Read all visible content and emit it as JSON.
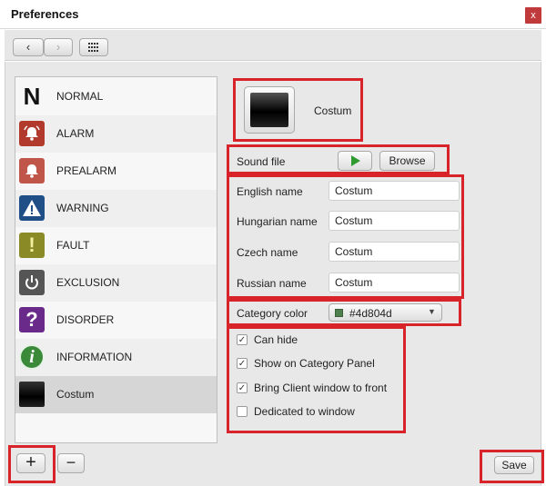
{
  "window": {
    "title": "Preferences",
    "close_glyph": "x"
  },
  "toolbar": {
    "back_glyph": "‹",
    "forward_glyph": "›"
  },
  "categories": [
    {
      "label": "NORMAL",
      "icon": "normal-icon"
    },
    {
      "label": "ALARM",
      "icon": "alarm-bell-icon"
    },
    {
      "label": "PREALARM",
      "icon": "prealarm-bell-icon"
    },
    {
      "label": "WARNING",
      "icon": "warning-triangle-icon"
    },
    {
      "label": "FAULT",
      "icon": "fault-exclamation-icon"
    },
    {
      "label": "EXCLUSION",
      "icon": "power-icon"
    },
    {
      "label": "DISORDER",
      "icon": "question-icon"
    },
    {
      "label": "INFORMATION",
      "icon": "info-icon"
    },
    {
      "label": "Costum",
      "icon": "custom-black-icon"
    }
  ],
  "detail": {
    "preview_name": "Costum",
    "sound_file_label": "Sound file",
    "browse_label": "Browse",
    "names": [
      {
        "label": "English name",
        "value": "Costum"
      },
      {
        "label": "Hungarian name",
        "value": "Costum"
      },
      {
        "label": "Czech name",
        "value": "Costum"
      },
      {
        "label": "Russian name",
        "value": "Costum"
      }
    ],
    "category_color_label": "Category color",
    "category_color_value": "#4d804d",
    "options": [
      {
        "label": "Can hide",
        "checked": true
      },
      {
        "label": "Show on Category Panel",
        "checked": true
      },
      {
        "label": "Bring Client window to front",
        "checked": true
      },
      {
        "label": "Dedicated to window",
        "checked": false
      }
    ]
  },
  "footer": {
    "save_label": "Save",
    "add_glyph": "+",
    "remove_glyph": "−"
  },
  "colors": {
    "highlight_red": "#d8232a",
    "category_color": "#4d804d",
    "play_green": "#2f9a2f"
  }
}
